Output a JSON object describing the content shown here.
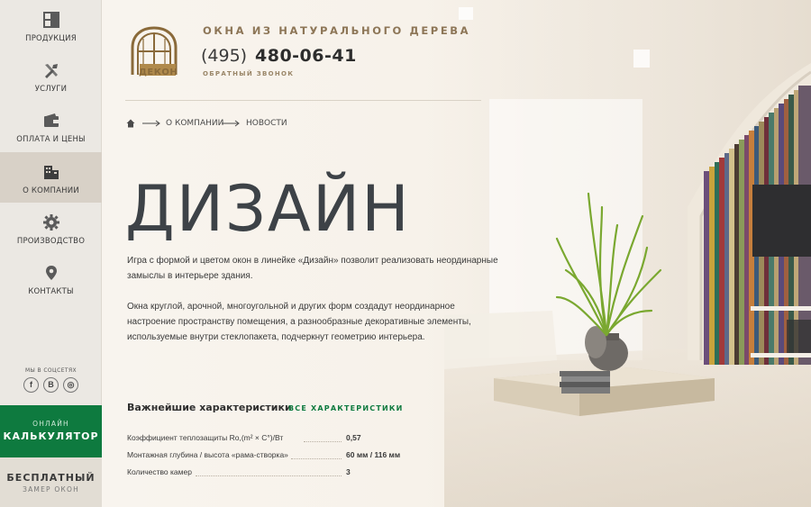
{
  "sidebar": {
    "items": [
      {
        "label": "ПРОДУКЦИЯ",
        "icon": "window-icon",
        "active": false
      },
      {
        "label": "УСЛУГИ",
        "icon": "tools-icon",
        "active": false
      },
      {
        "label": "ОПЛАТА И ЦЕНЫ",
        "icon": "wallet-icon",
        "active": false
      },
      {
        "label": "О КОМПАНИИ",
        "icon": "building-icon",
        "active": true
      },
      {
        "label": "ПРОИЗВОДСТВО",
        "icon": "gear-icon",
        "active": false
      },
      {
        "label": "КОНТАКТЫ",
        "icon": "map-pin-icon",
        "active": false
      }
    ],
    "social_title": "МЫ В СОЦСЕТЯХ",
    "social": [
      {
        "label": "f",
        "icon": "facebook-icon"
      },
      {
        "label": "В",
        "icon": "vkontakte-icon"
      },
      {
        "label": "◎",
        "icon": "instagram-icon"
      }
    ],
    "calculator": {
      "top": "ОНЛАЙН",
      "main": "КАЛЬКУЛЯТОР"
    },
    "measure": {
      "main": "БЕСПЛАТНЫЙ",
      "sub": "ЗАМЕР ОКОН"
    }
  },
  "header": {
    "logo_text": "ДЕКОН",
    "tagline": "ОКНА ИЗ НАТУРАЛЬНОГО ДЕРЕВА",
    "phone_code": "(495)",
    "phone_number": "480-06-41",
    "callback": "ОБРАТНЫЙ ЗВОНОК"
  },
  "breadcrumb": [
    "О КОМПАНИИ",
    "НОВОСТИ"
  ],
  "page": {
    "title": "ДИЗАЙН",
    "paragraphs": [
      "Игра с формой и цветом окон в линейке «Дизайн» позволит реализовать неординарные замыслы в интерьере здания.",
      "Окна круглой, арочной, многоугольной и других форм создадут неординарное настроение пространству помещения, а разнообразные декоративные элементы, используемые внутри стеклопакета, подчеркнут геометрию интерьера."
    ]
  },
  "specs": {
    "title": "Важнейшие характеристики",
    "link": "ВСЕ ХАРАКТЕРИСТИКИ",
    "rows": [
      {
        "name": "Коэффициент теплозащиты Ro,(m² × C°)/Вт",
        "value": "0,57"
      },
      {
        "name": "Монтажная глубина / высота «рама-створка»",
        "value": "60 мм / 116 мм"
      },
      {
        "name": "Количество камер",
        "value": "3"
      }
    ]
  },
  "colors": {
    "accent_green": "#0e7a3f",
    "brand_gold": "#8d7657",
    "sidebar_bg": "#ebe8e3",
    "sidebar_active": "#d8d1c7"
  }
}
